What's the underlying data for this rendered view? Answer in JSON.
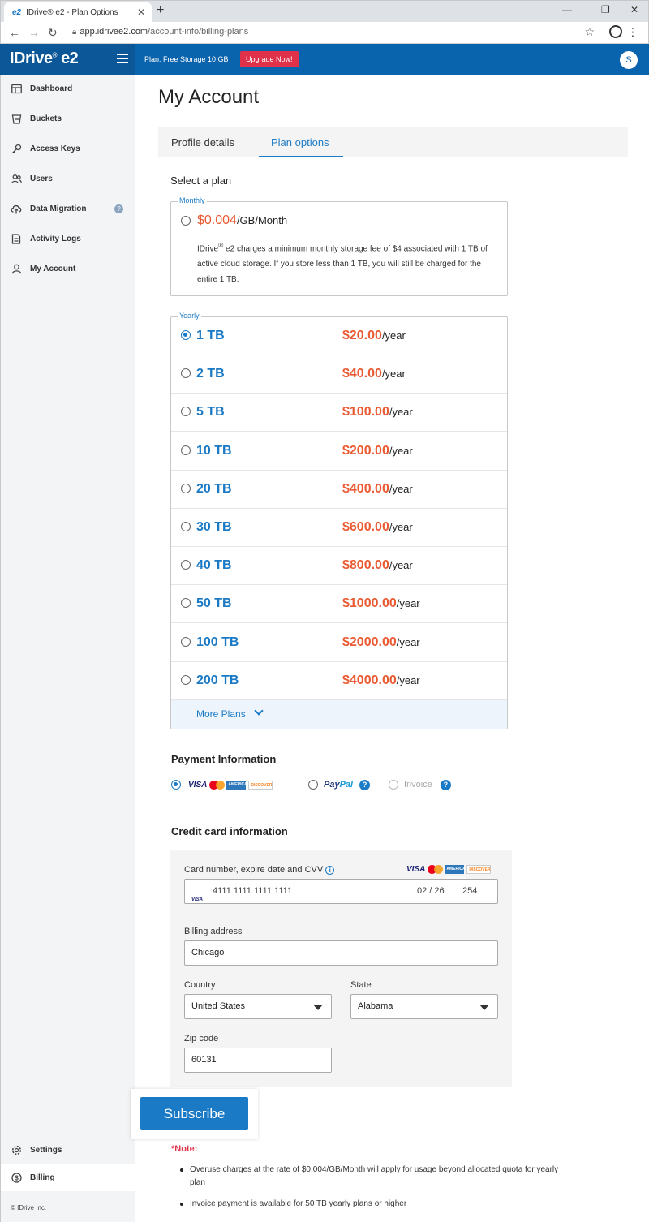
{
  "browser": {
    "tab_title": "IDrive® e2 - Plan Options",
    "tab_logo": "e2",
    "url_host": "app.idrivee2.com",
    "url_path": "/account-info/billing-plans"
  },
  "header": {
    "logo": "IDrive",
    "logo_suffix": "e2",
    "plan_text": "Plan: Free Storage 10 GB",
    "upgrade_label": "Upgrade Now!",
    "avatar_initial": "S"
  },
  "sidebar": {
    "items": [
      {
        "label": "Dashboard",
        "icon": "dashboard-icon"
      },
      {
        "label": "Buckets",
        "icon": "bucket-icon"
      },
      {
        "label": "Access Keys",
        "icon": "key-icon"
      },
      {
        "label": "Users",
        "icon": "users-icon"
      },
      {
        "label": "Data Migration",
        "icon": "cloud-migration-icon"
      },
      {
        "label": "Activity Logs",
        "icon": "log-icon"
      },
      {
        "label": "My Account",
        "icon": "user-icon"
      }
    ],
    "bottom_items": [
      {
        "label": "Settings",
        "icon": "gear-icon"
      },
      {
        "label": "Billing",
        "icon": "dollar-icon"
      }
    ],
    "help_mark": "?",
    "copyright": "© IDrive Inc."
  },
  "main": {
    "title": "My Account",
    "tabs": [
      {
        "label": "Profile details"
      },
      {
        "label": "Plan options"
      }
    ],
    "select_plan": "Select a plan",
    "monthly": {
      "legend": "Monthly",
      "price": "$0.004",
      "unit": "/GB/Month",
      "desc_brand": "IDrive",
      "desc_reg": "®",
      "desc": " e2 charges a minimum monthly storage fee of $4 associated with 1 TB of active cloud storage. If you store less than 1 TB, you will still be charged for the entire 1 TB."
    },
    "yearly": {
      "legend": "Yearly",
      "unit": "/year",
      "plans": [
        {
          "size": "1 TB",
          "price": "$20.00",
          "selected": true
        },
        {
          "size": "2 TB",
          "price": "$40.00",
          "selected": false
        },
        {
          "size": "5 TB",
          "price": "$100.00",
          "selected": false
        },
        {
          "size": "10 TB",
          "price": "$200.00",
          "selected": false
        },
        {
          "size": "20 TB",
          "price": "$400.00",
          "selected": false
        },
        {
          "size": "30 TB",
          "price": "$600.00",
          "selected": false
        },
        {
          "size": "40 TB",
          "price": "$800.00",
          "selected": false
        },
        {
          "size": "50 TB",
          "price": "$1000.00",
          "selected": false
        },
        {
          "size": "100 TB",
          "price": "$2000.00",
          "selected": false
        },
        {
          "size": "200 TB",
          "price": "$4000.00",
          "selected": false
        }
      ],
      "more_plans": "More Plans"
    },
    "payment": {
      "heading": "Payment Information",
      "paypal_pay": "Pay",
      "paypal_pal": "Pal",
      "invoice": "Invoice",
      "help_mark": "?",
      "card_visa": "VISA",
      "card_amex": "AMERICAN EXPRESS",
      "card_discover": "DISCOVER",
      "card_discover_sub": "NETWORK"
    },
    "credit_card": {
      "heading": "Credit card information",
      "card_label": "Card number, expire date and CVV",
      "info_mark": "i",
      "card_number": "4111 1111 1111 1111",
      "expiry": "02 / 26",
      "cvv": "254",
      "billing_label": "Billing address",
      "billing_value": "Chicago",
      "country_label": "Country",
      "country_value": "United States",
      "state_label": "State",
      "state_value": "Alabama",
      "zip_label": "Zip code",
      "zip_value": "60131"
    },
    "subscribe_label": "Subscribe",
    "note_heading": "*Note:",
    "notes": [
      "Overuse charges at the rate of $0.004/GB/Month will apply for usage beyond allocated quota for yearly plan",
      "Invoice payment is available for 50 TB yearly plans or higher"
    ]
  }
}
